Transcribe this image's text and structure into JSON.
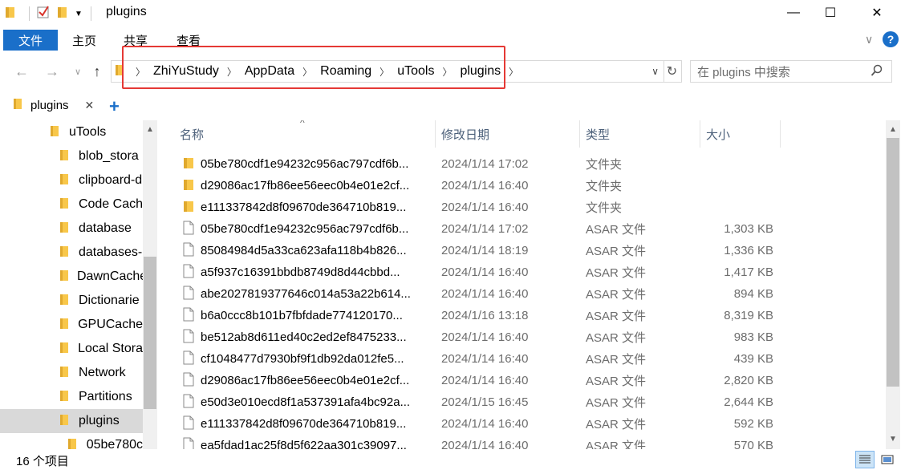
{
  "window": {
    "title": "plugins",
    "minimize_label": "—",
    "maximize_label": "☐",
    "close_label": "✕"
  },
  "ribbon": {
    "tabs": [
      "文件",
      "主页",
      "共享",
      "查看"
    ],
    "help": "?"
  },
  "address": {
    "breadcrumbs": [
      "ZhiYuStudy",
      "AppData",
      "Roaming",
      "uTools",
      "plugins"
    ]
  },
  "search": {
    "placeholder": "在 plugins 中搜索"
  },
  "tab": {
    "label": "plugins",
    "close": "✕",
    "add": "+"
  },
  "nav_pane": {
    "items": [
      {
        "label": "uTools",
        "level": 1,
        "selected": false
      },
      {
        "label": "blob_stora",
        "level": 2,
        "selected": false
      },
      {
        "label": "clipboard-d",
        "level": 2,
        "selected": false
      },
      {
        "label": "Code Cach",
        "level": 2,
        "selected": false
      },
      {
        "label": "database",
        "level": 2,
        "selected": false
      },
      {
        "label": "databases-",
        "level": 2,
        "selected": false
      },
      {
        "label": "DawnCache",
        "level": 2,
        "selected": false
      },
      {
        "label": "Dictionarie",
        "level": 2,
        "selected": false
      },
      {
        "label": "GPUCache",
        "level": 2,
        "selected": false
      },
      {
        "label": "Local Stora",
        "level": 2,
        "selected": false
      },
      {
        "label": "Network",
        "level": 2,
        "selected": false
      },
      {
        "label": "Partitions",
        "level": 2,
        "selected": false
      },
      {
        "label": "plugins",
        "level": 2,
        "selected": true
      },
      {
        "label": "05be780c",
        "level": 3,
        "selected": false
      }
    ]
  },
  "columns": {
    "name": "名称",
    "date": "修改日期",
    "type": "类型",
    "size": "大小"
  },
  "files": [
    {
      "name": "05be780cdf1e94232c956ac797cdf6b...",
      "date": "2024/1/14 17:02",
      "type": "文件夹",
      "size": "",
      "kind": "folder"
    },
    {
      "name": "d29086ac17fb86ee56eec0b4e01e2cf...",
      "date": "2024/1/14 16:40",
      "type": "文件夹",
      "size": "",
      "kind": "folder"
    },
    {
      "name": "e111337842d8f09670de364710b819...",
      "date": "2024/1/14 16:40",
      "type": "文件夹",
      "size": "",
      "kind": "folder"
    },
    {
      "name": "05be780cdf1e94232c956ac797cdf6b...",
      "date": "2024/1/14 17:02",
      "type": "ASAR 文件",
      "size": "1,303 KB",
      "kind": "file"
    },
    {
      "name": "85084984d5a33ca623afa118b4b826...",
      "date": "2024/1/14 18:19",
      "type": "ASAR 文件",
      "size": "1,336 KB",
      "kind": "file"
    },
    {
      "name": "a5f937c16391bbdb8749d8d44cbbd...",
      "date": "2024/1/14 16:40",
      "type": "ASAR 文件",
      "size": "1,417 KB",
      "kind": "file"
    },
    {
      "name": "abe2027819377646c014a53a22b614...",
      "date": "2024/1/14 16:40",
      "type": "ASAR 文件",
      "size": "894 KB",
      "kind": "file"
    },
    {
      "name": "b6a0ccc8b101b7fbfdade774120170...",
      "date": "2024/1/16 13:18",
      "type": "ASAR 文件",
      "size": "8,319 KB",
      "kind": "file"
    },
    {
      "name": "be512ab8d611ed40c2ed2ef8475233...",
      "date": "2024/1/14 16:40",
      "type": "ASAR 文件",
      "size": "983 KB",
      "kind": "file"
    },
    {
      "name": "cf1048477d7930bf9f1db92da012fe5...",
      "date": "2024/1/14 16:40",
      "type": "ASAR 文件",
      "size": "439 KB",
      "kind": "file"
    },
    {
      "name": "d29086ac17fb86ee56eec0b4e01e2cf...",
      "date": "2024/1/14 16:40",
      "type": "ASAR 文件",
      "size": "2,820 KB",
      "kind": "file"
    },
    {
      "name": "e50d3e010ecd8f1a537391afa4bc92a...",
      "date": "2024/1/15 16:45",
      "type": "ASAR 文件",
      "size": "2,644 KB",
      "kind": "file"
    },
    {
      "name": "e111337842d8f09670de364710b819...",
      "date": "2024/1/14 16:40",
      "type": "ASAR 文件",
      "size": "592 KB",
      "kind": "file"
    },
    {
      "name": "ea5fdad1ac25f8d5f622aa301c39097...",
      "date": "2024/1/14 16:40",
      "type": "ASAR 文件",
      "size": "570 KB",
      "kind": "file"
    }
  ],
  "status": {
    "item_count": "16 个项目"
  },
  "colors": {
    "accent": "#1a6fc9",
    "folder": "#f8c74a",
    "highlight_border": "#e53935",
    "selected_bg": "#d9d9d9"
  }
}
